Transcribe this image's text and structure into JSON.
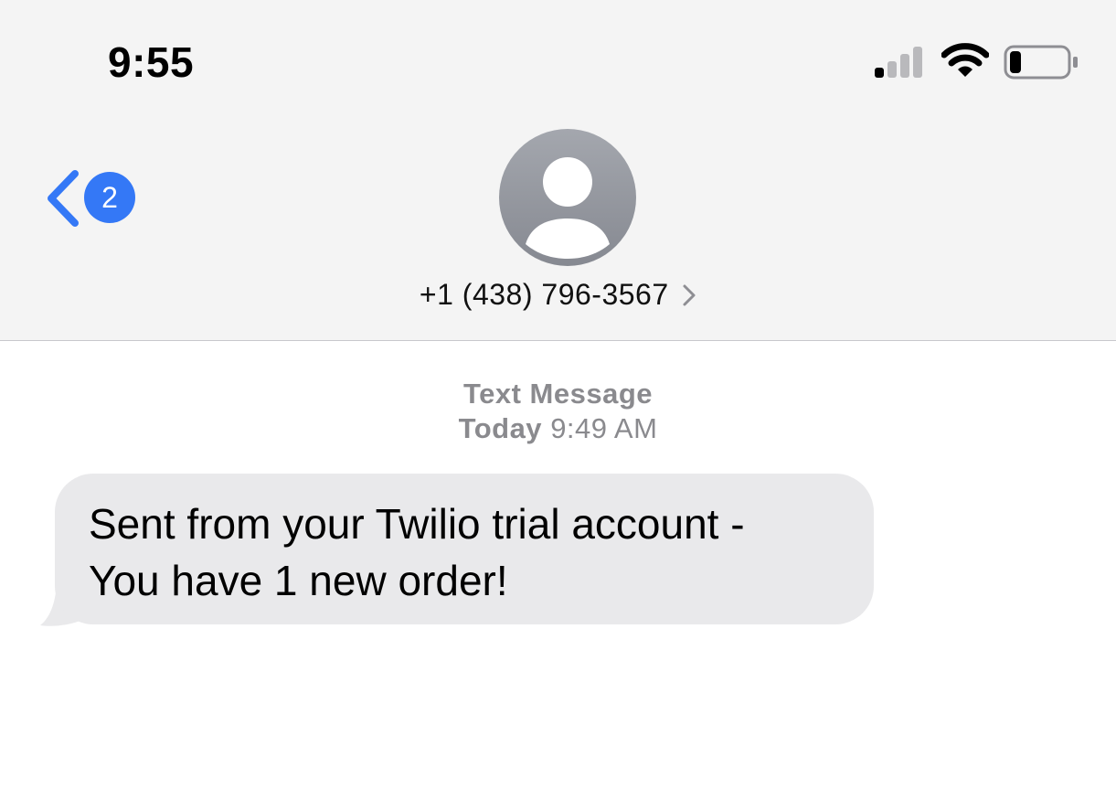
{
  "status_bar": {
    "time": "9:55",
    "signal_icon": "cellular-signal-icon",
    "wifi_icon": "wifi-icon",
    "battery_icon": "battery-icon",
    "battery_level": 0.2
  },
  "nav": {
    "back_icon": "chevron-left-icon",
    "unread_count": "2",
    "contact_name": "+1 (438) 796-3567",
    "contact_chevron_icon": "chevron-right-icon",
    "avatar_icon": "person-icon"
  },
  "thread": {
    "message_type": "Text Message",
    "day": "Today",
    "time": "9:49 AM",
    "messages": [
      {
        "direction": "incoming",
        "text_line1": "Sent from your Twilio trial account -",
        "text_line2": "You have 1 new order!"
      }
    ]
  },
  "colors": {
    "accent": "#3478f6",
    "header_bg": "#f4f4f4",
    "bubble_incoming": "#e9e9eb",
    "meta_text": "#8a8a8e"
  }
}
